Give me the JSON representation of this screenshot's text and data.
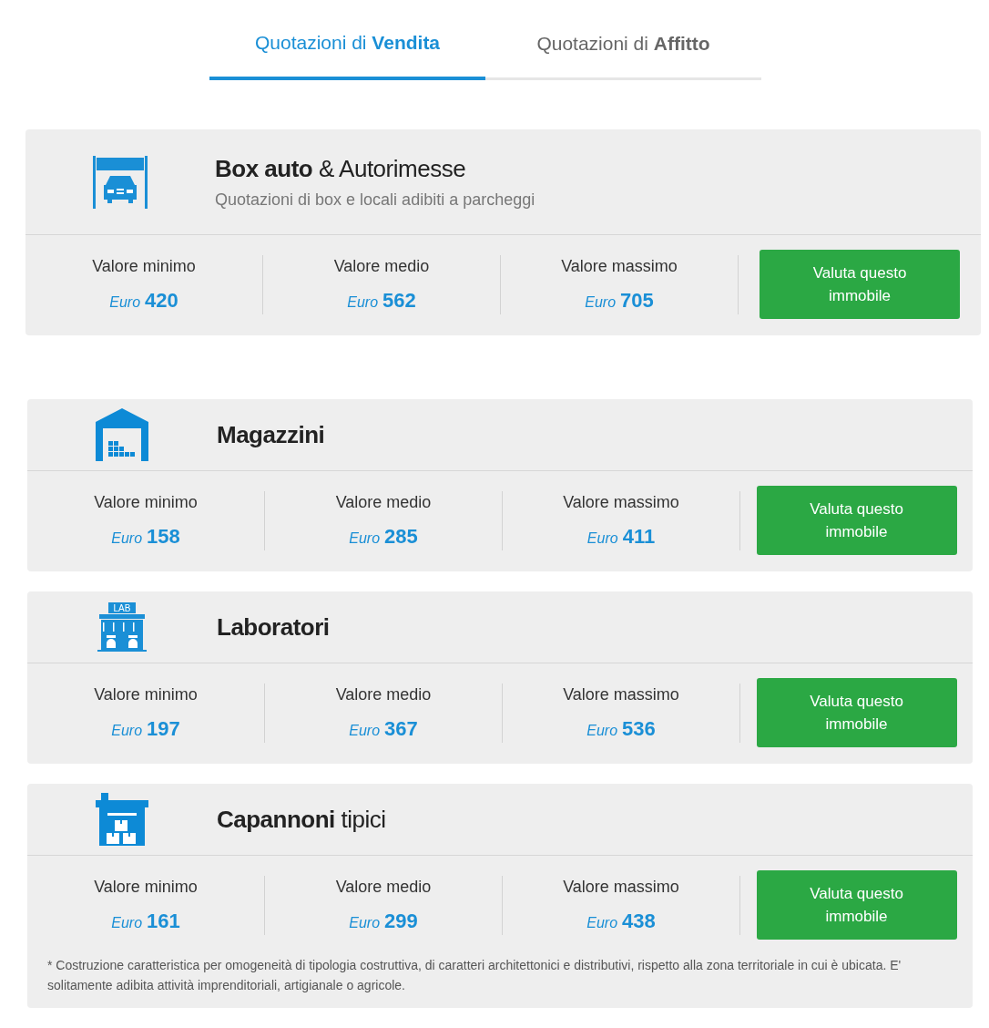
{
  "tabs": [
    {
      "label": "Quotazioni di **Vendita**",
      "selected": true
    },
    {
      "label": "Quotazioni di **Affitto**",
      "selected": false
    }
  ],
  "cards": [
    {
      "kind": "garage",
      "title": "**Box auto** & Autorimesse",
      "subtitle": "Quotazioni di box e locali adibiti a parcheggi",
      "values": [
        {
          "label": "Valore minimo",
          "currency": "Euro",
          "amount": "420"
        },
        {
          "label": "Valore medio",
          "currency": "Euro",
          "amount": "562"
        },
        {
          "label": "Valore massimo",
          "currency": "Euro",
          "amount": "705"
        }
      ],
      "button": "Valuta questo immobile"
    },
    {
      "kind": "warehouse",
      "title": "**Magazzini**",
      "values": [
        {
          "label": "Valore minimo",
          "currency": "Euro",
          "amount": "158"
        },
        {
          "label": "Valore medio",
          "currency": "Euro",
          "amount": "285"
        },
        {
          "label": "Valore massimo",
          "currency": "Euro",
          "amount": "411"
        }
      ],
      "button": "Valuta questo immobile"
    },
    {
      "kind": "lab",
      "icon_label": "LAB",
      "title": "**Laboratori**",
      "values": [
        {
          "label": "Valore minimo",
          "currency": "Euro",
          "amount": "197"
        },
        {
          "label": "Valore medio",
          "currency": "Euro",
          "amount": "367"
        },
        {
          "label": "Valore massimo",
          "currency": "Euro",
          "amount": "536"
        }
      ],
      "button": "Valuta questo immobile"
    },
    {
      "kind": "shed",
      "title": "**Capannoni** tipici",
      "values": [
        {
          "label": "Valore minimo",
          "currency": "Euro",
          "amount": "161"
        },
        {
          "label": "Valore medio",
          "currency": "Euro",
          "amount": "299"
        },
        {
          "label": "Valore massimo",
          "currency": "Euro",
          "amount": "438"
        }
      ],
      "button": "Valuta questo immobile",
      "note": "* Costruzione caratteristica per omogeneità di tipologia costruttiva, di caratteri architettonici e distributivi, rispetto alla zona territoriale in cui è ubicata. E' solitamente adibita attività imprenditoriali, artigianale o agricole."
    }
  ]
}
